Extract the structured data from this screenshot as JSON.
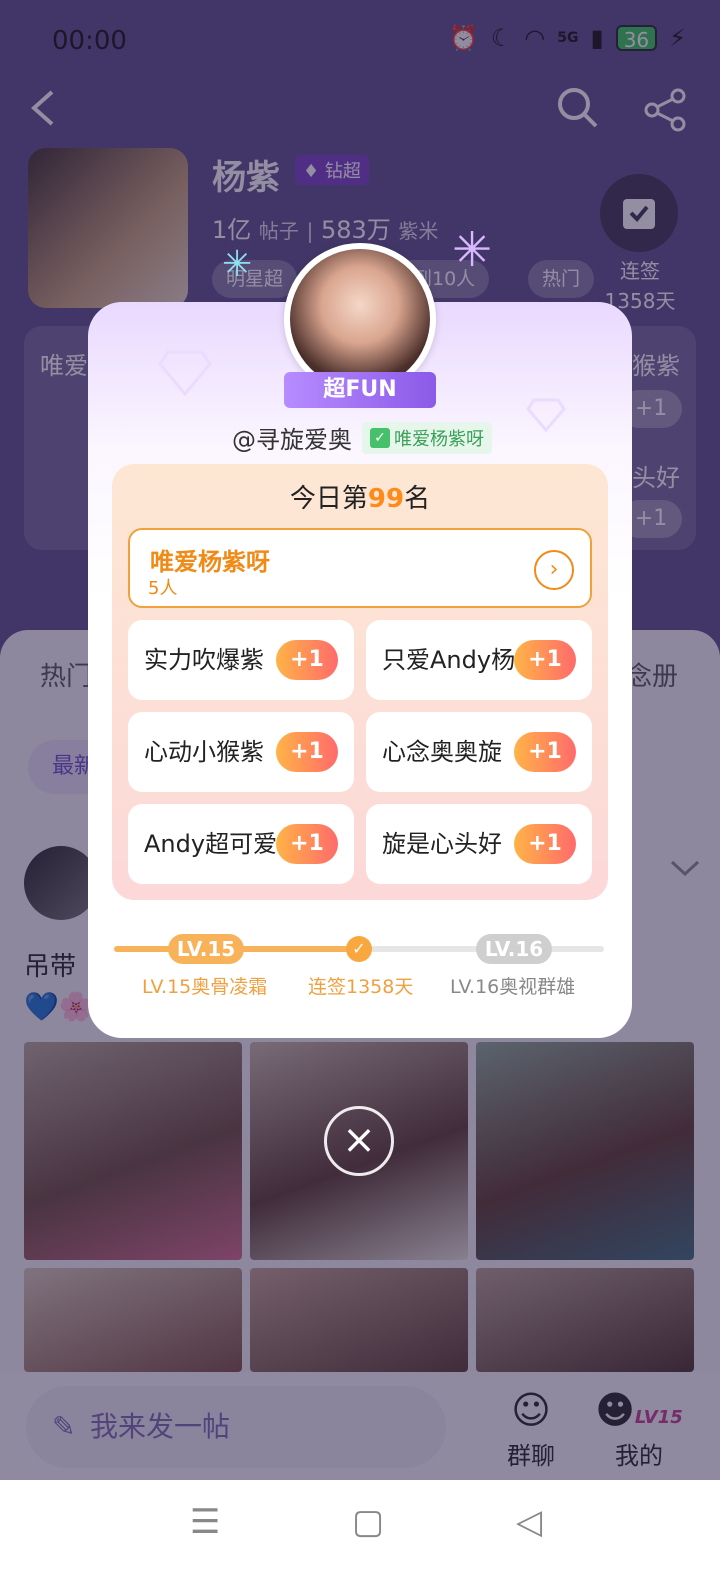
{
  "status_bar": {
    "time": "00:00",
    "battery": "36",
    "network": "5G"
  },
  "header": {
    "title": "杨紫",
    "badge": "钻超",
    "posts_count": "1亿",
    "posts_label": "帖子",
    "members_count": "583万",
    "members_label": "紫米",
    "chips": [
      "明星超",
      "签到10人",
      "热门"
    ],
    "checkin_label": "连签",
    "checkin_days": "1358天"
  },
  "side_groups": [
    {
      "name": "唯爱",
      "plus": "+1"
    },
    {
      "name": "猴紫",
      "plus": "+1"
    },
    {
      "name": "头好",
      "plus": "+1"
    }
  ],
  "tabs": [
    "热门",
    "念册"
  ],
  "filter_label": "最新",
  "post": {
    "text": "吊带",
    "emoji": "💙🌸"
  },
  "bottom_bar": {
    "composer_placeholder": "我来发一帖",
    "group_chat": "群聊",
    "mine": "我的",
    "level_badge": "LV15"
  },
  "modal": {
    "fun_badge": "超FUN",
    "username": "@寻旋爱奥",
    "group_tag": "唯爱杨紫呀",
    "rank_prefix": "今日第",
    "rank_number": "99",
    "rank_suffix": "名",
    "main_group": {
      "name": "唯爱杨紫呀",
      "count": "5人"
    },
    "groups": [
      {
        "name": "实力吹爆紫",
        "plus": "+1"
      },
      {
        "name": "只爱Andy杨",
        "plus": "+1"
      },
      {
        "name": "心动小猴紫",
        "plus": "+1"
      },
      {
        "name": "心念奥奥旋",
        "plus": "+1"
      },
      {
        "name": "Andy超可爱",
        "plus": "+1"
      },
      {
        "name": "旋是心头好",
        "plus": "+1"
      }
    ],
    "progress": {
      "current_level": "LV.15",
      "next_level": "LV.16",
      "current_title": "LV.15奥骨凌霜",
      "streak": "连签1358天",
      "next_title": "LV.16奥视群雄",
      "fraction": 0.5
    },
    "close_symbol": "×"
  },
  "colors": {
    "accent": "#7b3fc4",
    "orange": "#f08a18",
    "plus_gradient_start": "#ffb347",
    "plus_gradient_end": "#ff6b6b"
  }
}
